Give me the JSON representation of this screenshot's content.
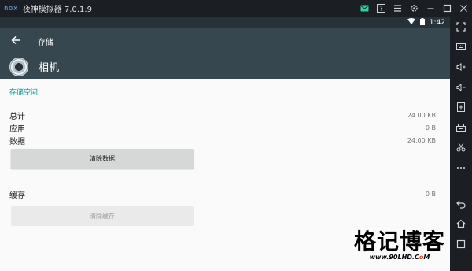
{
  "emulator": {
    "logo": "nox",
    "title": "夜神模拟器 7.0.1.9",
    "titlebar_icons": [
      "mail-icon",
      "help-icon",
      "menu-icon",
      "settings-icon",
      "minimize-icon",
      "maximize-icon",
      "close-icon"
    ],
    "sidebar_icons": [
      "fullscreen-icon",
      "keyboard-icon",
      "volume-up-icon",
      "volume-down-icon",
      "add-apk-icon",
      "screenshot-toolbox-icon",
      "scissors-icon",
      "more-icon",
      "back-icon",
      "home-icon",
      "recent-icon"
    ]
  },
  "statusbar": {
    "time": "1:42"
  },
  "appbar": {
    "title": "存储"
  },
  "app": {
    "name": "相机"
  },
  "storage": {
    "section_title": "存储空间",
    "rows": [
      {
        "label": "总计",
        "value": "24.00 KB"
      },
      {
        "label": "应用",
        "value": "0 B"
      },
      {
        "label": "数据",
        "value": "24.00 KB"
      }
    ],
    "clear_data_label": "清除数据"
  },
  "cache": {
    "label": "缓存",
    "value": "0 B",
    "clear_cache_label": "清除缓存"
  },
  "watermark": {
    "title": "格记博客",
    "site_prefix": "www.90LHD.C",
    "site_red": "o",
    "site_suffix": "M"
  }
}
